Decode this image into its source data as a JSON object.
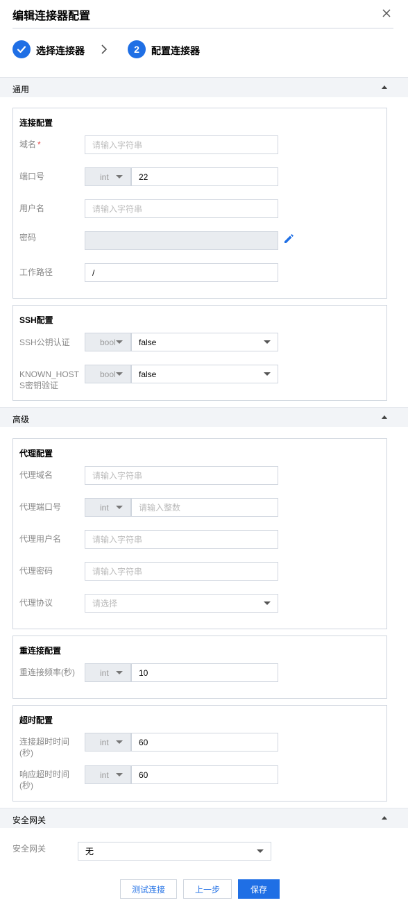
{
  "dialog": {
    "title": "编辑连接器配置"
  },
  "steps": [
    {
      "label": "选择连接器"
    },
    {
      "number": "2",
      "label": "配置连接器"
    }
  ],
  "sections": {
    "general": "通用",
    "advanced": "高级",
    "security": "安全网关"
  },
  "connection": {
    "title": "连接配置",
    "domain": {
      "label": "域名",
      "required": "*",
      "placeholder": "请输入字符串"
    },
    "port": {
      "label": "端口号",
      "type": "int",
      "value": "22"
    },
    "username": {
      "label": "用户名",
      "placeholder": "请输入字符串"
    },
    "password": {
      "label": "密码",
      "value": ""
    },
    "workdir": {
      "label": "工作路径",
      "value": "/"
    }
  },
  "ssh": {
    "title": "SSH配置",
    "pubkey": {
      "label": "SSH公钥认证",
      "type": "bool",
      "value": "false"
    },
    "known_hosts": {
      "label_line1": "KNOWN_HOST",
      "label_line2": "S密钥验证",
      "type": "bool",
      "value": "false"
    }
  },
  "proxy": {
    "title": "代理配置",
    "domain": {
      "label": "代理域名",
      "placeholder": "请输入字符串"
    },
    "port": {
      "label": "代理端口号",
      "type": "int",
      "placeholder": "请输入整数"
    },
    "username": {
      "label": "代理用户名",
      "placeholder": "请输入字符串"
    },
    "password": {
      "label": "代理密码",
      "placeholder": "请输入字符串"
    },
    "protocol": {
      "label": "代理协议",
      "placeholder": "请选择"
    }
  },
  "reconnect": {
    "title": "重连接配置",
    "frequency": {
      "label": "重连接频率(秒)",
      "type": "int",
      "value": "10"
    }
  },
  "timeout": {
    "title": "超时配置",
    "connect": {
      "label_line1": "连接超时时间",
      "label_line2": "(秒)",
      "type": "int",
      "value": "60"
    },
    "response": {
      "label_line1": "响应超时时间",
      "label_line2": "(秒)",
      "type": "int",
      "value": "60"
    }
  },
  "gateway": {
    "label": "安全网关",
    "value": "无"
  },
  "buttons": {
    "test": "测试连接",
    "prev": "上一步",
    "save": "保存"
  },
  "colors": {
    "primary": "#1f6fe5",
    "required": "#e54545"
  },
  "icons": {
    "close": "close-icon",
    "check": "check-icon",
    "chevron": "chevron-right-icon",
    "edit": "pencil-icon"
  }
}
